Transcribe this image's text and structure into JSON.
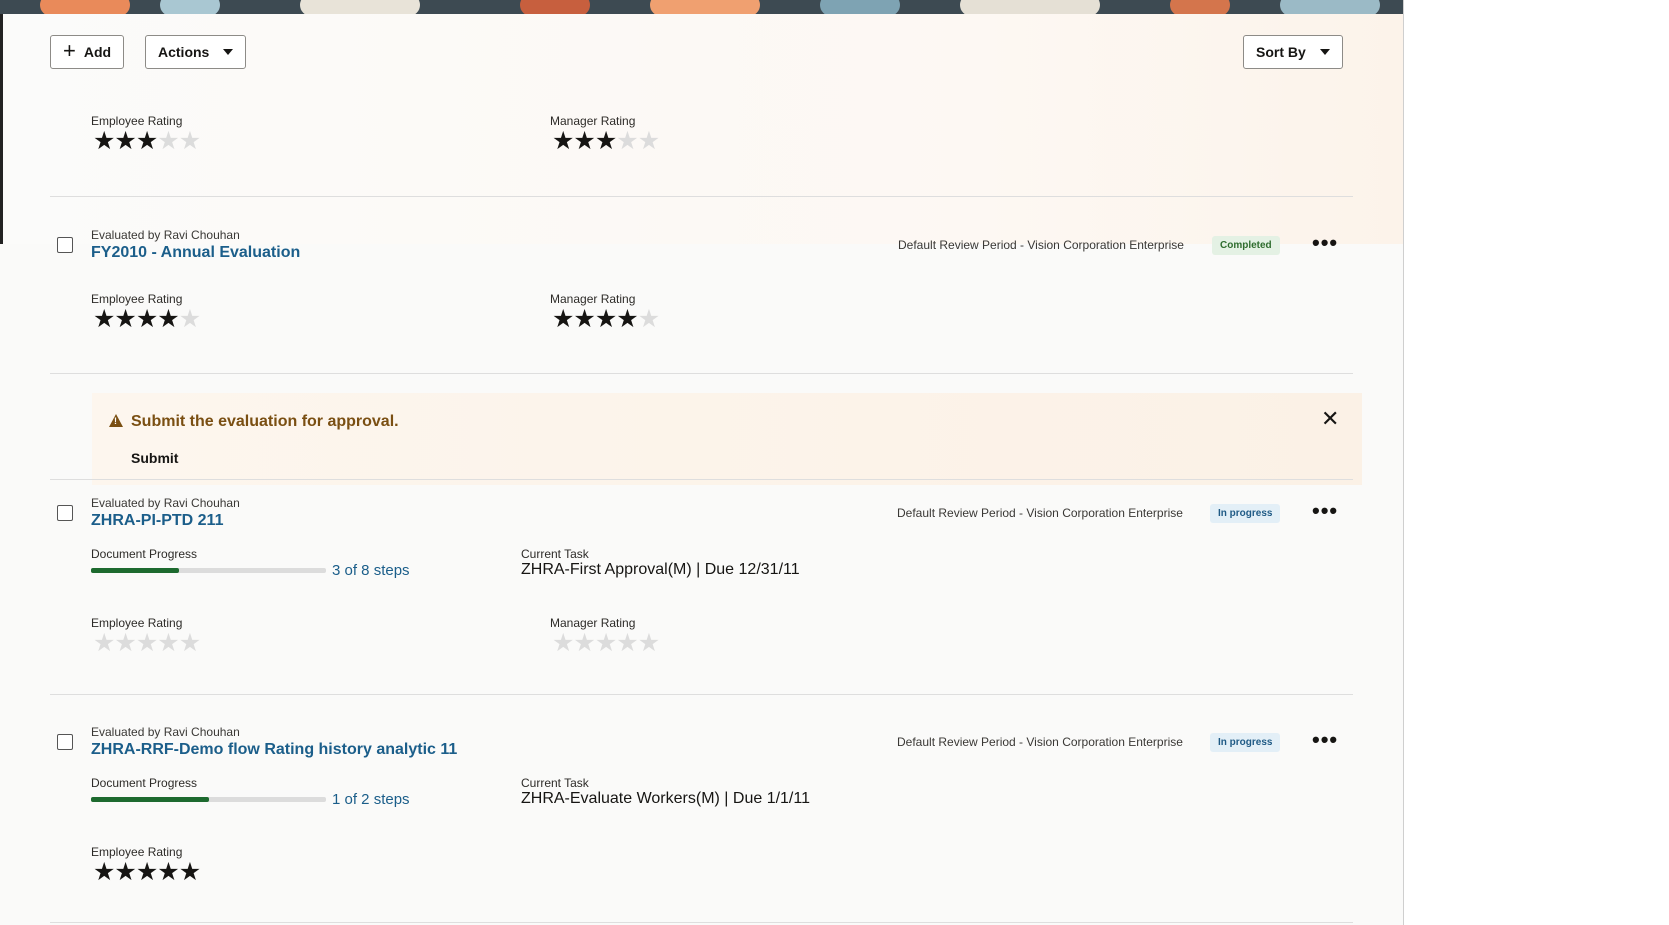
{
  "toolbar": {
    "add_label": "Add",
    "actions_label": "Actions",
    "sort_label": "Sort By"
  },
  "top_item": {
    "employee_rating_label": "Employee Rating",
    "employee_rating": 3,
    "manager_rating_label": "Manager Rating",
    "manager_rating": 3
  },
  "items": [
    {
      "evaluated_by": "Evaluated by Ravi Chouhan",
      "title": "FY2010 - Annual Evaluation",
      "period": "Default Review Period - Vision Corporation Enterprise",
      "status": "Completed",
      "employee_rating_label": "Employee Rating",
      "employee_rating": 4,
      "manager_rating_label": "Manager Rating",
      "manager_rating": 4
    },
    {
      "evaluated_by": "Evaluated by Ravi Chouhan",
      "title": "ZHRA-PI-PTD 211",
      "period": "Default Review Period - Vision Corporation Enterprise",
      "status": "In progress",
      "progress_label": "Document Progress",
      "progress_fraction": 0.375,
      "progress_text": "3 of 8 steps",
      "task_label": "Current Task",
      "task": "ZHRA-First Approval(M) | Due 12/31/11",
      "employee_rating_label": "Employee Rating",
      "employee_rating": 0,
      "manager_rating_label": "Manager Rating",
      "manager_rating": 0
    },
    {
      "evaluated_by": "Evaluated by Ravi Chouhan",
      "title": "ZHRA-RRF-Demo flow Rating history analytic 11",
      "period": "Default Review Period - Vision Corporation Enterprise",
      "status": "In progress",
      "progress_label": "Document Progress",
      "progress_fraction": 0.5,
      "progress_text": "1 of 2 steps",
      "task_label": "Current Task",
      "task": "ZHRA-Evaluate Workers(M) | Due 1/1/11",
      "employee_rating_label": "Employee Rating",
      "employee_rating": 5
    }
  ],
  "alert": {
    "message": "Submit the evaluation for approval.",
    "action_label": "Submit"
  },
  "colors": {
    "link": "#1b5e8a",
    "progress": "#1d6a2f",
    "warning": "#7a4f12"
  },
  "icons": {
    "add": "plus-icon",
    "caret": "caret-down-icon",
    "more": "more-options-icon",
    "warning": "warning-icon",
    "close": "close-icon",
    "star": "star-icon"
  }
}
